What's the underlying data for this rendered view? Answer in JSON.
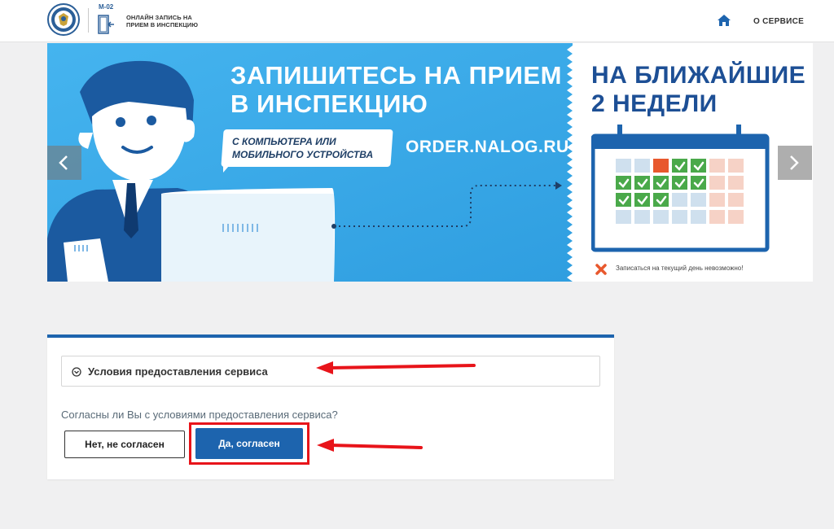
{
  "header": {
    "badge": "М-02",
    "brand_line1": "ОНЛАЙН ЗАПИСЬ НА",
    "brand_line2": "ПРИЕМ В ИНСПЕКЦИЮ",
    "home_icon": "home-icon",
    "about_label": "О СЕРВИСЕ"
  },
  "banner": {
    "headline_line1": "ЗАПИШИТЕСЬ НА ПРИЕМ",
    "headline_line2": "В ИНСПЕКЦИЮ",
    "bubble_line1": "С КОМПЬЮТЕРА ИЛИ",
    "bubble_line2": "МОБИЛЬНОГО УСТРОЙСТВА",
    "url": "ORDER.NALOG.RU",
    "right_line1": "НА БЛИЖАЙШИЕ",
    "right_line2": "2 НЕДЕЛИ",
    "note": "Записаться на текущий день невозможно!",
    "slides": 4,
    "active_slide": 1,
    "prev_icon": "chevron-left-icon",
    "next_icon": "chevron-right-icon"
  },
  "terms": {
    "accordion_title": "Условия предоставления сервиса",
    "question": "Согласны ли Вы с условиями предоставления сервиса?",
    "decline_label": "Нет, не согласен",
    "accept_label": "Да, согласен"
  },
  "colors": {
    "primary_blue": "#1d64ae",
    "banner_blue": "#3fa9e8",
    "highlight_red": "#e8141a",
    "page_bg": "#f0f0f1"
  }
}
